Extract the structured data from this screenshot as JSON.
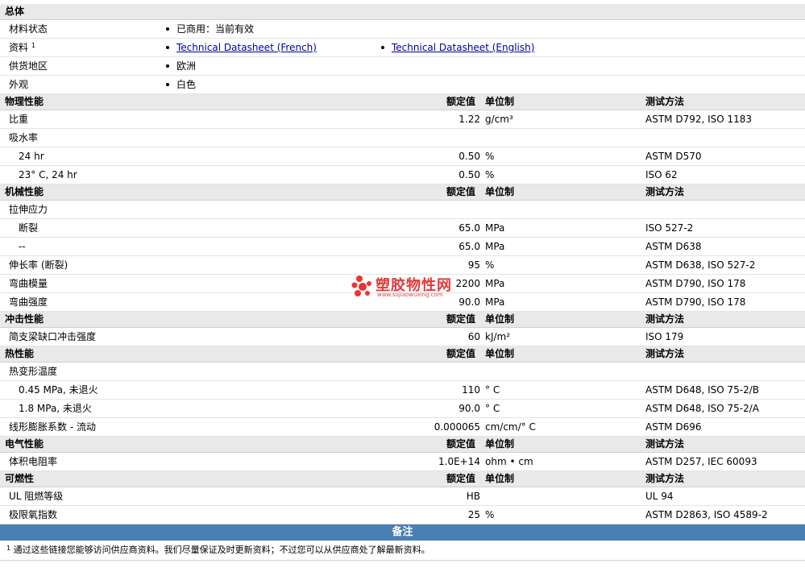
{
  "general": {
    "title": "总体",
    "rows": [
      {
        "label": "材料状态",
        "sup": "",
        "items": [
          {
            "text": "已商用：当前有效",
            "link": false
          }
        ]
      },
      {
        "label": "资料",
        "sup": "1",
        "items": [
          {
            "text": "Technical Datasheet (French)",
            "link": true
          },
          {
            "text": "Technical Datasheet (English)",
            "link": true
          }
        ]
      },
      {
        "label": "供货地区",
        "sup": "",
        "items": [
          {
            "text": "欧洲",
            "link": false
          }
        ]
      },
      {
        "label": "外观",
        "sup": "",
        "items": [
          {
            "text": "白色",
            "link": false
          }
        ]
      }
    ]
  },
  "sections": [
    {
      "title": "物理性能",
      "h_value": "额定值",
      "h_unit": "单位制",
      "h_test": "测试方法",
      "rows": [
        {
          "label": "比重",
          "sub": false,
          "value": "1.22",
          "unit": "g/cm³",
          "test": "ASTM D792, ISO 1183"
        },
        {
          "label": "吸水率",
          "sub": false,
          "value": "",
          "unit": "",
          "test": ""
        },
        {
          "label": "24 hr",
          "sub": true,
          "value": "0.50",
          "unit": "%",
          "test": "ASTM D570"
        },
        {
          "label": "23° C, 24 hr",
          "sub": true,
          "value": "0.50",
          "unit": "%",
          "test": "ISO 62"
        }
      ]
    },
    {
      "title": "机械性能",
      "h_value": "额定值",
      "h_unit": "单位制",
      "h_test": "测试方法",
      "rows": [
        {
          "label": "拉伸应力",
          "sub": false,
          "value": "",
          "unit": "",
          "test": ""
        },
        {
          "label": "断裂",
          "sub": true,
          "value": "65.0",
          "unit": "MPa",
          "test": "ISO 527-2"
        },
        {
          "label": "--",
          "sub": true,
          "value": "65.0",
          "unit": "MPa",
          "test": "ASTM D638"
        },
        {
          "label": "伸长率 (断裂)",
          "sub": false,
          "value": "95",
          "unit": "%",
          "test": "ASTM D638, ISO 527-2"
        },
        {
          "label": "弯曲模量",
          "sub": false,
          "value": "2200",
          "unit": "MPa",
          "test": "ASTM D790, ISO 178"
        },
        {
          "label": "弯曲强度",
          "sub": false,
          "value": "90.0",
          "unit": "MPa",
          "test": "ASTM D790, ISO 178"
        }
      ]
    },
    {
      "title": "冲击性能",
      "h_value": "额定值",
      "h_unit": "单位制",
      "h_test": "测试方法",
      "rows": [
        {
          "label": "简支梁缺口冲击强度",
          "sub": false,
          "value": "60",
          "unit": "kJ/m²",
          "test": "ISO 179"
        }
      ]
    },
    {
      "title": "热性能",
      "h_value": "额定值",
      "h_unit": "单位制",
      "h_test": "测试方法",
      "rows": [
        {
          "label": "热变形温度",
          "sub": false,
          "value": "",
          "unit": "",
          "test": ""
        },
        {
          "label": "0.45 MPa, 未退火",
          "sub": true,
          "value": "110",
          "unit": "° C",
          "test": "ASTM D648, ISO 75-2/B"
        },
        {
          "label": "1.8 MPa, 未退火",
          "sub": true,
          "value": "90.0",
          "unit": "° C",
          "test": "ASTM D648, ISO 75-2/A"
        },
        {
          "label": "线形膨胀系数 - 流动",
          "sub": false,
          "value": "0.000065",
          "unit": "cm/cm/° C",
          "test": "ASTM D696"
        }
      ]
    },
    {
      "title": "电气性能",
      "h_value": "额定值",
      "h_unit": "单位制",
      "h_test": "测试方法",
      "rows": [
        {
          "label": "体积电阻率",
          "sub": false,
          "value": "1.0E+14",
          "unit": "ohm • cm",
          "test": "ASTM D257, IEC 60093"
        }
      ]
    },
    {
      "title": "可燃性",
      "h_value": "额定值",
      "h_unit": "单位制",
      "h_test": "测试方法",
      "rows": [
        {
          "label": "UL 阻燃等级",
          "sub": false,
          "value": "HB",
          "unit": "",
          "test": "UL 94"
        },
        {
          "label": "极限氧指数",
          "sub": false,
          "value": "25",
          "unit": "%",
          "test": "ASTM D2863, ISO 4589-2"
        }
      ]
    }
  ],
  "notes": {
    "title": "备注",
    "sup": "1",
    "text": "通过这些链接您能够访问供应商资料。我们尽量保证及时更新资料；不过您可以从供应商处了解最新资料。"
  },
  "watermark": {
    "text": "塑胶物性网",
    "url": "www.sujiaowuxing.com"
  }
}
